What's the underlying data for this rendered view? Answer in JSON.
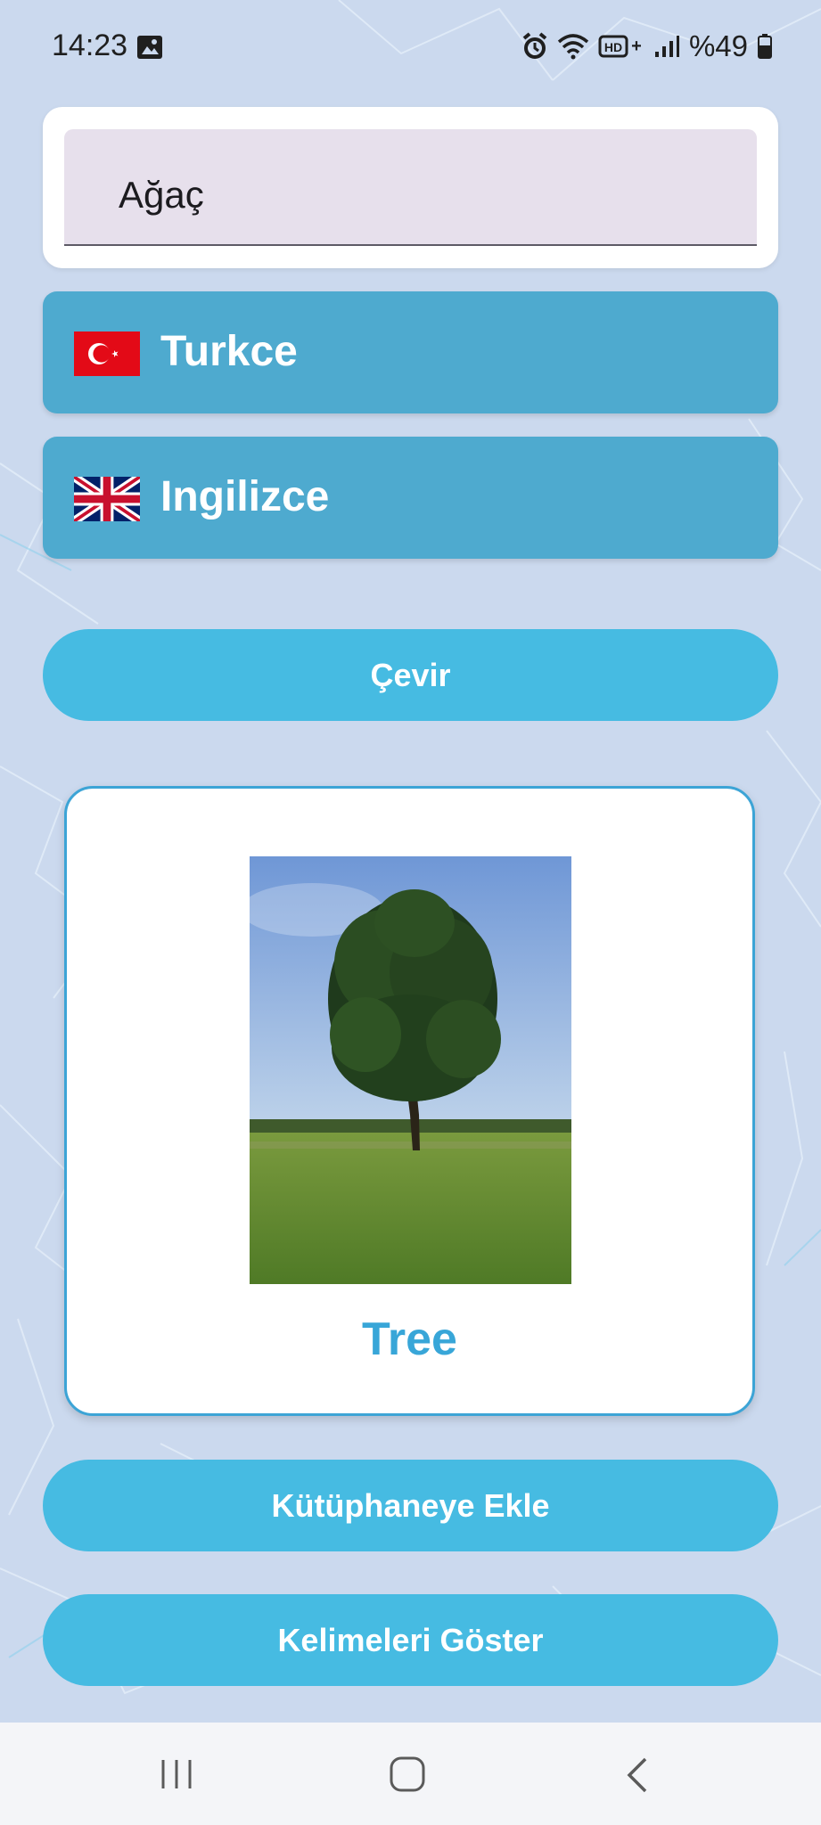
{
  "status_bar": {
    "time": "14:23",
    "battery": "%49",
    "icons": [
      "gallery-icon",
      "alarm-icon",
      "wifi-icon",
      "hd-voice-icon",
      "signal-icon",
      "battery-icon"
    ]
  },
  "input": {
    "value": "Ağaç"
  },
  "source_language": {
    "label": "Turkce",
    "flag": "turkey-flag-icon"
  },
  "target_language": {
    "label": "Ingilizce",
    "flag": "uk-flag-icon"
  },
  "translate_button": {
    "label": "Çevir"
  },
  "result": {
    "word": "Tree",
    "image": "tree-photo"
  },
  "add_library_button": {
    "label": "Kütüphaneye Ekle"
  },
  "show_words_button": {
    "label": "Kelimeleri Göster"
  },
  "nav_bar": {
    "icons": [
      "recent-apps-icon",
      "home-icon",
      "back-icon"
    ]
  },
  "colors": {
    "background": "#cbd9ee",
    "language_button": "#4eaacf",
    "action_button": "#46bbe2",
    "result_border": "#3ca4d6",
    "result_text": "#38a6d8"
  }
}
